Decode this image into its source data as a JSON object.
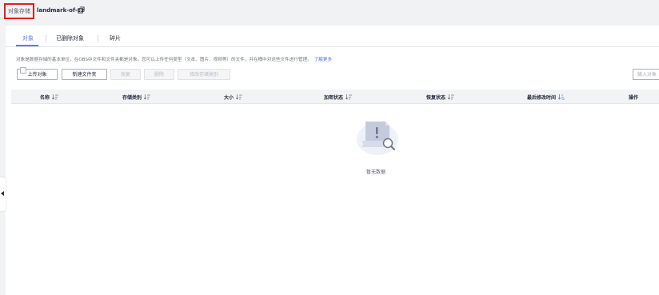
{
  "breadcrumb": {
    "root": "对象存储",
    "bucket": "landmark-of-sz"
  },
  "tabs": [
    {
      "label": "对象",
      "active": true
    },
    {
      "label": "已删除对象",
      "active": false
    },
    {
      "label": "碎片",
      "active": false
    }
  ],
  "description": {
    "text": "对象是数据存储的基本单位，在OBS中文件和文件夹都是对象。您可以上传任何类型（文本、图片、视频等）的文件，并在桶中对这些文件进行管理。",
    "link": "了解更多"
  },
  "toolbar": {
    "upload": "上传对象",
    "new_folder": "新建文件夹",
    "restore": "恢复",
    "delete": "删除",
    "change_storage_class": "修改存储类别"
  },
  "search": {
    "placeholder": "输入对象"
  },
  "table": {
    "columns": {
      "name": "名称",
      "storage_class": "存储类别",
      "size": "大小",
      "encryption": "加密状态",
      "restore_status": "恢复状态",
      "last_modified": "最后修改时间",
      "actions": "操作"
    }
  },
  "empty": {
    "text": "暂无数据"
  },
  "colors": {
    "accent": "#5e7ce0",
    "highlight_box": "#e02020"
  }
}
